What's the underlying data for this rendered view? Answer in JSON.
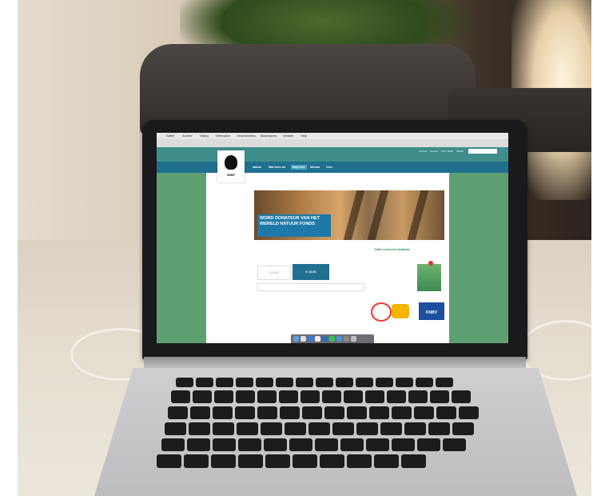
{
  "browser": {
    "menu_items": [
      "Safari",
      "Archief",
      "Wijzig",
      "Weergave",
      "Geschiedenis",
      "Bladwijzers",
      "Venster",
      "Help"
    ]
  },
  "site": {
    "logo_text": "WWF",
    "top_links": [
      "Contact",
      "Nieuws",
      "Over WWF",
      "Winkel"
    ],
    "nav_items": [
      {
        "label": "Natuur",
        "active": false
      },
      {
        "label": "Wat doen we",
        "active": false
      },
      {
        "label": "Help mee",
        "active": true
      },
      {
        "label": "Nieuws",
        "active": false
      },
      {
        "label": "Over",
        "active": false
      }
    ],
    "hero_title": "Word donateur van het Wereld Natuur Fonds",
    "amount_placeholder": "€ 5,00",
    "amount_button": "€ 15,00",
    "sidebar_title": "Gratis exclusieve bedankje",
    "partner3_label": "KNBV"
  },
  "colors": {
    "header": "#3f8e8c",
    "nav": "#1f6f8f",
    "background": "#5fa072",
    "accent": "#1e79a8"
  }
}
